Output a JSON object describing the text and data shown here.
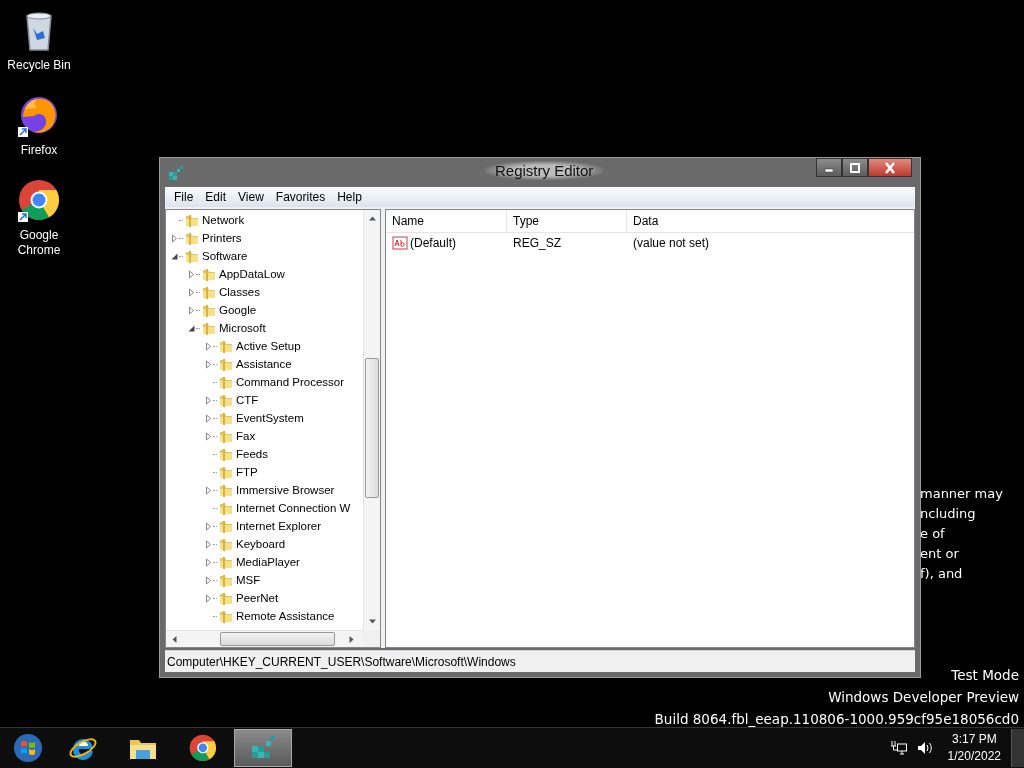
{
  "desktop_icons": [
    {
      "kind": "recycle",
      "label": "Recycle Bin"
    },
    {
      "kind": "firefox",
      "label": "Firefox"
    },
    {
      "kind": "chrome",
      "label": "Google Chrome"
    }
  ],
  "background_text": [
    "manner may",
    "ncluding",
    "e of",
    "ent or",
    "f), and"
  ],
  "window": {
    "title": "Registry Editor",
    "menu": [
      "File",
      "Edit",
      "View",
      "Favorites",
      "Help"
    ],
    "tree": [
      {
        "label": "Network",
        "kind": "leaf"
      },
      {
        "label": "Printers",
        "kind": "branch",
        "expanded": false
      },
      {
        "label": "Software",
        "kind": "branch",
        "expanded": true,
        "children": [
          {
            "label": "AppDataLow",
            "kind": "branch",
            "expanded": false
          },
          {
            "label": "Classes",
            "kind": "branch",
            "expanded": false
          },
          {
            "label": "Google",
            "kind": "branch",
            "expanded": false
          },
          {
            "label": "Microsoft",
            "kind": "branch",
            "expanded": true,
            "children": [
              {
                "label": "Active Setup",
                "kind": "branch",
                "expanded": false
              },
              {
                "label": "Assistance",
                "kind": "branch",
                "expanded": false
              },
              {
                "label": "Command Processor",
                "kind": "leaf"
              },
              {
                "label": "CTF",
                "kind": "branch",
                "expanded": false
              },
              {
                "label": "EventSystem",
                "kind": "branch",
                "expanded": false
              },
              {
                "label": "Fax",
                "kind": "branch",
                "expanded": false
              },
              {
                "label": "Feeds",
                "kind": "leaf"
              },
              {
                "label": "FTP",
                "kind": "leaf"
              },
              {
                "label": "Immersive Browser",
                "kind": "branch",
                "expanded": false
              },
              {
                "label": "Internet Connection W",
                "kind": "leaf"
              },
              {
                "label": "Internet Explorer",
                "kind": "branch",
                "expanded": false
              },
              {
                "label": "Keyboard",
                "kind": "branch",
                "expanded": false
              },
              {
                "label": "MediaPlayer",
                "kind": "branch",
                "expanded": false
              },
              {
                "label": "MSF",
                "kind": "branch",
                "expanded": false
              },
              {
                "label": "PeerNet",
                "kind": "branch",
                "expanded": false
              },
              {
                "label": "Remote Assistance",
                "kind": "leaf"
              }
            ]
          }
        ]
      }
    ],
    "list": {
      "columns": [
        "Name",
        "Type",
        "Data"
      ],
      "rows": [
        {
          "kind": "string",
          "name": "(Default)",
          "type": "REG_SZ",
          "data": "(value not set)"
        }
      ]
    },
    "status_bar": "Computer\\HKEY_CURRENT_USER\\Software\\Microsoft\\Windows"
  },
  "desktop_notice": [
    "Test Mode",
    "Windows Developer Preview",
    "Build 8064.fbl_eeap.110806-1000.959cf95e18056cd0"
  ],
  "taskbar": {
    "apps": [
      {
        "kind": "start",
        "active": false
      },
      {
        "kind": "ie",
        "active": false
      },
      {
        "kind": "explorer",
        "active": false
      },
      {
        "kind": "chrome",
        "active": false
      },
      {
        "kind": "regedit",
        "active": true
      }
    ],
    "clock": {
      "time": "3:17 PM",
      "date": "1/20/2022"
    }
  }
}
